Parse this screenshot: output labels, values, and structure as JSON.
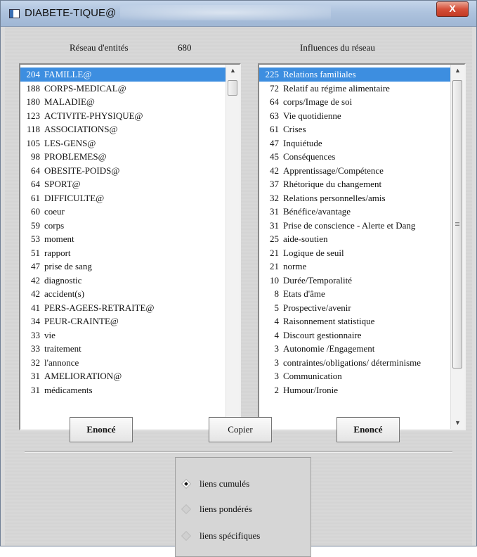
{
  "window": {
    "title": "DIABETE-TIQUE@",
    "close_label": "X"
  },
  "left": {
    "header_label": "Réseau d'entités",
    "header_count": "680",
    "items": [
      {
        "num": "204",
        "label": "FAMILLE@",
        "selected": true
      },
      {
        "num": "188",
        "label": "CORPS-MEDICAL@"
      },
      {
        "num": "180",
        "label": "MALADIE@"
      },
      {
        "num": "123",
        "label": "ACTIVITE-PHYSIQUE@"
      },
      {
        "num": "118",
        "label": "ASSOCIATIONS@"
      },
      {
        "num": "105",
        "label": "LES-GENS@"
      },
      {
        "num": "98",
        "label": "PROBLEMES@"
      },
      {
        "num": "64",
        "label": "OBESITE-POIDS@"
      },
      {
        "num": "64",
        "label": "SPORT@"
      },
      {
        "num": "61",
        "label": "DIFFICULTE@"
      },
      {
        "num": "60",
        "label": "coeur"
      },
      {
        "num": "59",
        "label": "corps"
      },
      {
        "num": "53",
        "label": "moment"
      },
      {
        "num": "51",
        "label": "rapport"
      },
      {
        "num": "47",
        "label": "prise de sang"
      },
      {
        "num": "42",
        "label": "diagnostic"
      },
      {
        "num": "42",
        "label": "accident(s)"
      },
      {
        "num": "41",
        "label": "PERS-AGEES-RETRAITE@"
      },
      {
        "num": "34",
        "label": "PEUR-CRAINTE@"
      },
      {
        "num": "33",
        "label": "vie"
      },
      {
        "num": "33",
        "label": "traitement"
      },
      {
        "num": "32",
        "label": "l'annonce"
      },
      {
        "num": "31",
        "label": "AMELIORATION@"
      },
      {
        "num": "31",
        "label": "médicaments"
      }
    ]
  },
  "right": {
    "header_label": "Influences du réseau",
    "items": [
      {
        "num": "225",
        "label": "Relations familiales",
        "selected": true
      },
      {
        "num": "72",
        "label": "Relatif au régime alimentaire"
      },
      {
        "num": "64",
        "label": "corps/Image de soi"
      },
      {
        "num": "63",
        "label": "Vie quotidienne"
      },
      {
        "num": "61",
        "label": "Crises"
      },
      {
        "num": "47",
        "label": "Inquiétude"
      },
      {
        "num": "45",
        "label": "Conséquences"
      },
      {
        "num": "42",
        "label": "Apprentissage/Compétence"
      },
      {
        "num": "37",
        "label": "Rhétorique du changement"
      },
      {
        "num": "32",
        "label": "Relations personnelles/amis"
      },
      {
        "num": "31",
        "label": "Bénéfice/avantage"
      },
      {
        "num": "31",
        "label": "Prise de conscience - Alerte et Dang"
      },
      {
        "num": "25",
        "label": "aide-soutien"
      },
      {
        "num": "21",
        "label": "Logique de seuil"
      },
      {
        "num": "21",
        "label": "norme"
      },
      {
        "num": "10",
        "label": "Durée/Temporalité"
      },
      {
        "num": "8",
        "label": "Etats d'âme"
      },
      {
        "num": "5",
        "label": "Prospective/avenir"
      },
      {
        "num": "4",
        "label": "Raisonnement statistique"
      },
      {
        "num": "4",
        "label": "Discourt gestionnaire"
      },
      {
        "num": "3",
        "label": "Autonomie /Engagement"
      },
      {
        "num": "3",
        "label": "contraintes/obligations/ déterminisme"
      },
      {
        "num": "3",
        "label": "Communication"
      },
      {
        "num": "2",
        "label": "Humour/Ironie"
      }
    ]
  },
  "buttons": {
    "enonce_left": "Enoncé",
    "copier": "Copier",
    "enonce_right": "Enoncé"
  },
  "radios": [
    {
      "label": "liens cumulés",
      "checked": true
    },
    {
      "label": "liens pondérés",
      "checked": false
    },
    {
      "label": "liens spécifiques",
      "checked": false
    }
  ],
  "colors": {
    "selection": "#3d8ee0",
    "close_button": "#d5503a"
  },
  "icons": {
    "app": "window-app-icon",
    "close": "close-icon",
    "scroll_up": "arrow-up-icon",
    "scroll_down": "arrow-down-icon"
  }
}
